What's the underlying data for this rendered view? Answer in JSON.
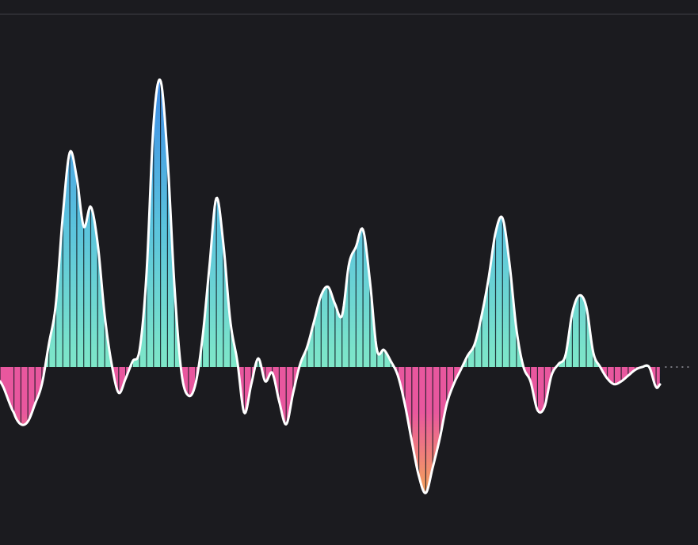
{
  "theme": {
    "background": "#1b1b1f",
    "top_rule": "#2d2d32",
    "outline": "#ffffff",
    "stripe": "#0f1720",
    "baseline_dots": "#9a9aa2",
    "pos_low": "#7fe8c8",
    "pos_mid": "#5bc3dd",
    "pos_high": "#3f8de6",
    "neg_low": "#e8579e",
    "neg_high": "#f39a62"
  },
  "chart_data": {
    "type": "area",
    "title": "",
    "xlabel": "",
    "ylabel": "",
    "grid": false,
    "legend": "none",
    "xlim": [
      0,
      100
    ],
    "ylim": [
      -1,
      1
    ],
    "baseline": 0,
    "series": [
      {
        "x": [
          0,
          2,
          3,
          4,
          5,
          6,
          7,
          8,
          9,
          10,
          11,
          12,
          13,
          14,
          15,
          16,
          17,
          18,
          19,
          20,
          21,
          22,
          23,
          24,
          25,
          26,
          27,
          28,
          29,
          30,
          31,
          32,
          33,
          34,
          35,
          36,
          37,
          38,
          39,
          40,
          41,
          42,
          43,
          44,
          45,
          46,
          47,
          48,
          49,
          50,
          51,
          52,
          53,
          54,
          55,
          56,
          57,
          58,
          59,
          60,
          61,
          62,
          63,
          64,
          65,
          66,
          67,
          68,
          69,
          70,
          71,
          72,
          73,
          74,
          75,
          76,
          77,
          78,
          79,
          80,
          81,
          82,
          83,
          84,
          85,
          86,
          87,
          88,
          89,
          90,
          91,
          92,
          93,
          94,
          94.6
        ],
        "values": [
          -0.05,
          -0.16,
          -0.2,
          -0.19,
          -0.13,
          -0.06,
          0.08,
          0.22,
          0.53,
          0.75,
          0.66,
          0.49,
          0.56,
          0.43,
          0.18,
          0.01,
          -0.09,
          -0.04,
          0.02,
          0.06,
          0.33,
          0.85,
          1.0,
          0.73,
          0.28,
          -0.02,
          -0.1,
          -0.06,
          0.1,
          0.35,
          0.59,
          0.43,
          0.16,
          0.02,
          -0.16,
          -0.06,
          0.03,
          -0.05,
          -0.02,
          -0.12,
          -0.2,
          -0.09,
          0.01,
          0.07,
          0.16,
          0.25,
          0.28,
          0.22,
          0.18,
          0.36,
          0.42,
          0.48,
          0.3,
          0.06,
          0.06,
          0.02,
          -0.03,
          -0.13,
          -0.26,
          -0.38,
          -0.44,
          -0.35,
          -0.25,
          -0.13,
          -0.06,
          -0.01,
          0.04,
          0.08,
          0.18,
          0.31,
          0.47,
          0.52,
          0.36,
          0.13,
          0.0,
          -0.05,
          -0.15,
          -0.14,
          -0.03,
          0.01,
          0.04,
          0.19,
          0.25,
          0.21,
          0.05,
          0.0,
          -0.04,
          -0.06,
          -0.05,
          -0.03,
          -0.01,
          0.0,
          0.0,
          -0.07,
          -0.06
        ]
      }
    ]
  }
}
